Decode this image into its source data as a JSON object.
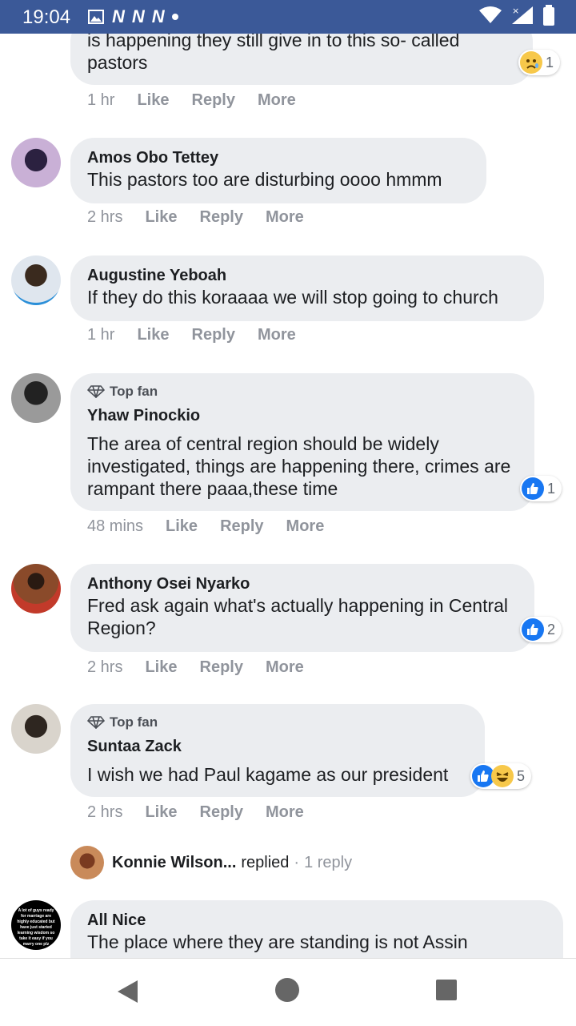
{
  "status_bar": {
    "time": "19:04",
    "network_letters": [
      "N",
      "N",
      "N"
    ]
  },
  "comments": [
    {
      "text": "is happening they still give in to this so- called pastors",
      "time": "1 hr",
      "reaction_count": "1"
    },
    {
      "name": "Amos Obo Tettey",
      "text": "This pastors too are disturbing oooo hmmm",
      "time": "2 hrs"
    },
    {
      "name": "Augustine Yeboah",
      "text": "If they do this koraaaa we will stop going to church",
      "time": "1 hr"
    },
    {
      "badge": "Top fan",
      "name": "Yhaw Pinockio",
      "text": "The area of central region should be widely investigated, things are happening there, crimes are rampant there paaa,these time",
      "time": "48 mins",
      "reaction_count": "1"
    },
    {
      "name": "Anthony Osei Nyarko",
      "text": "Fred ask again what's actually happening in Central Region?",
      "time": "2 hrs",
      "reaction_count": "2"
    },
    {
      "badge": "Top fan",
      "name": "Suntaa Zack",
      "text": "I wish we had Paul kagame as our president",
      "time": "2 hrs",
      "reaction_count": "5"
    },
    {
      "name": "All Nice",
      "text": "The place where they are standing is not Assin"
    }
  ],
  "actions": {
    "like": "Like",
    "reply": "Reply",
    "more": "More"
  },
  "reply_summary": {
    "name": "Konnie Wilson...",
    "verb": "replied",
    "sep": "·",
    "count": "1 reply"
  },
  "avatar_text": "A lot of guys ready for marriage are highly educated but have just started learning wisdom so take it easy if you marry one plz"
}
